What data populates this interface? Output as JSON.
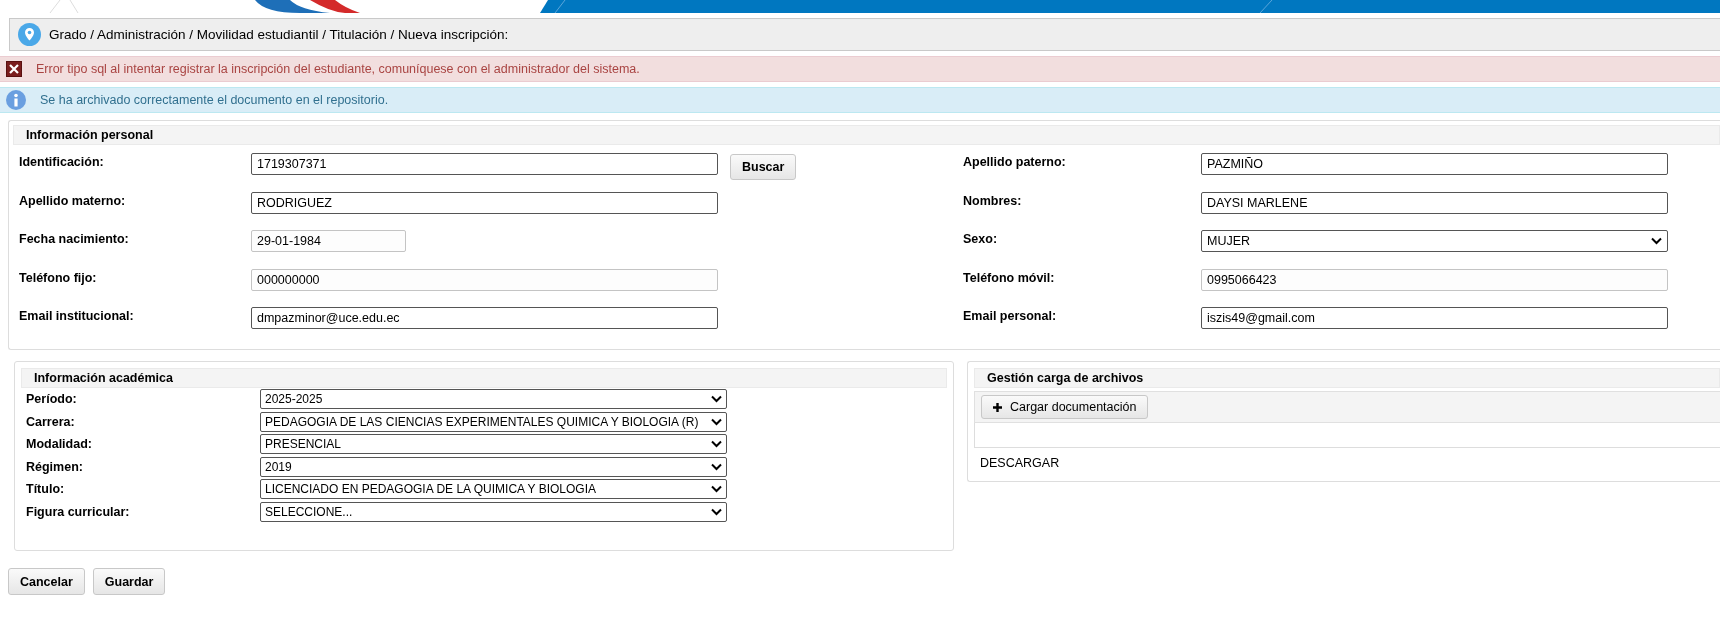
{
  "breadcrumb": "Grado / Administración / Movilidad estudiantil / Titulación / Nueva inscripción:",
  "alerts": [
    {
      "kind": "error",
      "text": "Error tipo sql al intentar registrar la inscripción del estudiante, comuníquese con el administrador del sistema."
    },
    {
      "kind": "info",
      "text": "Se ha archivado correctamente el documento en el repositorio."
    }
  ],
  "personal": {
    "title": "Información personal",
    "left": [
      {
        "label": "Identificación:",
        "kind": "text",
        "value": "1719307371",
        "readonly": false,
        "button": "Buscar"
      },
      {
        "label": "Apellido materno:",
        "kind": "text",
        "value": "RODRIGUEZ",
        "readonly": false
      },
      {
        "label": "Fecha nacimiento:",
        "kind": "date",
        "value": "29-01-1984",
        "readonly": true
      },
      {
        "label": "Teléfono fijo:",
        "kind": "text",
        "value": "000000000",
        "readonly": true
      },
      {
        "label": "Email institucional:",
        "kind": "text",
        "value": "dmpazminor@uce.edu.ec",
        "readonly": false
      }
    ],
    "right": [
      {
        "label": "Apellido paterno:",
        "kind": "text",
        "value": "PAZMIÑO",
        "readonly": false
      },
      {
        "label": "Nombres:",
        "kind": "text",
        "value": "DAYSI MARLENE",
        "readonly": false
      },
      {
        "label": "Sexo:",
        "kind": "select",
        "value": "MUJER"
      },
      {
        "label": "Teléfono móvil:",
        "kind": "text",
        "value": "0995066423",
        "readonly": true
      },
      {
        "label": "Email personal:",
        "kind": "text",
        "value": "iszis49@gmail.com",
        "readonly": false
      }
    ]
  },
  "academic": {
    "title": "Información académica",
    "fields": [
      {
        "label": "Período:",
        "kind": "select",
        "value": "2025-2025"
      },
      {
        "label": "Carrera:",
        "kind": "select",
        "value": "PEDAGOGIA DE LAS CIENCIAS EXPERIMENTALES QUIMICA Y BIOLOGIA (R)"
      },
      {
        "label": "Modalidad:",
        "kind": "select",
        "value": "PRESENCIAL"
      },
      {
        "label": "Régimen:",
        "kind": "select",
        "value": "2019"
      },
      {
        "label": "Título:",
        "kind": "select",
        "value": "LICENCIADO EN PEDAGOGIA DE LA QUIMICA Y BIOLOGIA"
      },
      {
        "label": "Figura curricular:",
        "kind": "select",
        "value": "SELECCIONE..."
      }
    ]
  },
  "files": {
    "title": "Gestión carga de archivos",
    "upload_button": "Cargar documentación",
    "download_link": "DESCARGAR"
  },
  "buttons": [
    "Cancelar",
    "Guardar"
  ]
}
